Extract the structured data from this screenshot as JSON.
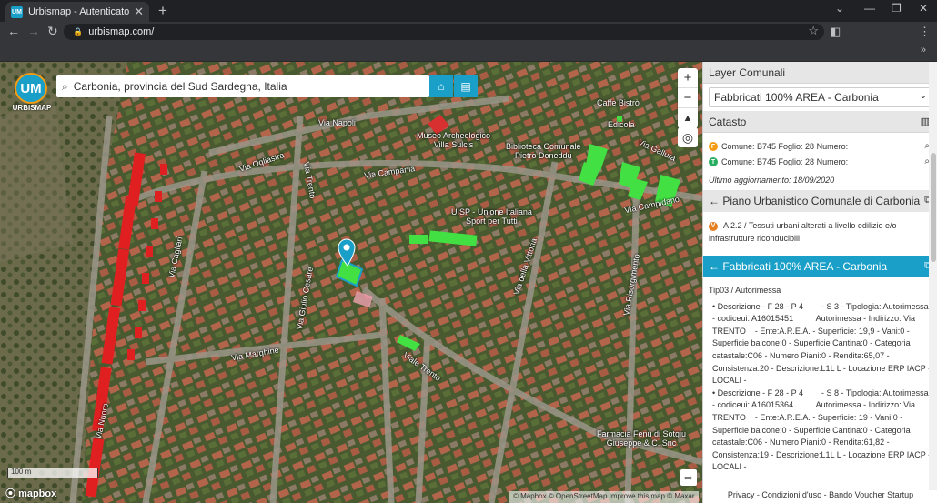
{
  "browser": {
    "tab_title": "Urbismap - Autenticato come ut",
    "tab_close": "✕",
    "new_tab": "+",
    "url": "urbismap.com/",
    "window_controls": [
      "⌄",
      "—",
      "❐",
      "✕"
    ]
  },
  "map": {
    "logo_text": "UM",
    "logo_name": "URBISMAP",
    "search_value": "Carbonia, provincia del Sud Sardegna, Italia",
    "scale": "100 m",
    "mapbox_brand": "mapbox",
    "attribution": "© Mapbox © OpenStreetMap  Improve this map  © Maxar",
    "labels": {
      "via_napoli": "Via Napoli",
      "via_ogliastra": "Via Ogliastra",
      "via_campania": "Via Campania",
      "via_gallura": "Via Gallura",
      "via_campidano": "Via Campidano",
      "via_cagliari": "Via Cagliari",
      "via_trento_vertical": "Via Trento",
      "viale_trento": "Viale Trento",
      "via_vittoria": "Via della Vittoria",
      "via_marghine": "Via Marghine",
      "via_risorgimento": "Via Risorgimento",
      "via_giulio_cesare": "Via Giulio Cesare",
      "via_nuoro": "Via Nuoro",
      "museo": "Museo Archeologico\nVilla Sulcis",
      "biblioteca": "Biblioteca Comunale\nPietro Doneddu",
      "uisp": "UISP - Unione Italiana\nSport per Tutti",
      "caffe": "Caffe Bistrò",
      "edicola": "Edicola",
      "farmacia": "Farmacia Fenu di Sotgiu\nGiuseppe & C. Snc"
    }
  },
  "panel": {
    "layer_header": "Layer Comunali",
    "layer_selected": "Fabbricati 100% AREA - Carbonia",
    "catasto_header": "Catasto",
    "catasto_rows": [
      {
        "badge": "F",
        "color": "#f39c12",
        "text": "Comune: B745 Foglio: 28 Numero:"
      },
      {
        "badge": "T",
        "color": "#27ae60",
        "text": "Comune: B745 Foglio: 28 Numero:"
      }
    ],
    "last_update": "Ultimo aggiornamento: 18/09/2020",
    "puc_header": "← Piano Urbanistico Comunale di Carbonia",
    "puc_badge": "V",
    "puc_text": "A 2.2 / Tessuti urbani alterati a livello edilizio e/o infrastrutture riconducibili",
    "fab_header": "← Fabbricati 100% AREA - Carbonia",
    "tip": "Tip03 / Autorimessa",
    "records": [
      "• Descrizione - F 28 - P 4        - S 3 - Tipologia: Autorimessa - codiceui: A16015451          Autorimessa - Indirizzo: Via TRENTO    - Ente:A.R.E.A. - Superficie: 19,9 - Vani:0 - Superficie balcone:0 - Superficie Cantina:0 - Categoria catastale:C06 - Numero Piani:0 - Rendita:65,07 - Consistenza:20 - Descrizione:L1L L - Locazione ERP IACP - LOCALI -",
      "• Descrizione - F 28 - P 4        - S 8 - Tipologia: Autorimessa - codiceui: A16015364          Autorimessa - Indirizzo: Via TRENTO    - Ente:A.R.E.A. - Superficie: 19 - Vani:0 - Superficie balcone:0 - Superficie Cantina:0 - Categoria catastale:C06 - Numero Piani:0 - Rendita:61,82 - Consistenza:19 - Descrizione:L1L L - Locazione ERP IACP - LOCALI -"
    ],
    "footer": "Privacy  -  Condizioni d'uso  -  Bando Voucher Startup"
  }
}
